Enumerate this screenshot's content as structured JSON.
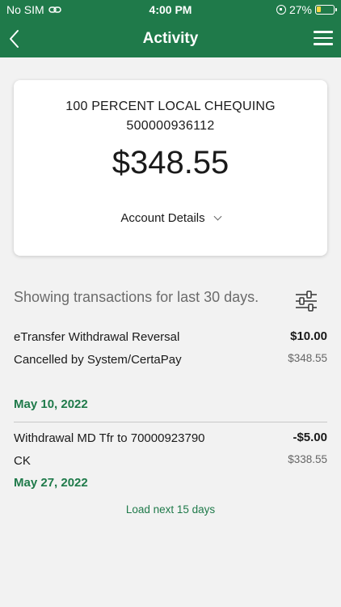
{
  "status_bar": {
    "carrier": "No SIM",
    "time": "4:00 PM",
    "battery": "27%",
    "battery_level": 0.27
  },
  "nav": {
    "title": "Activity"
  },
  "account": {
    "name": "100 PERCENT LOCAL CHEQUING",
    "number": "500000936112",
    "balance": "$348.55",
    "details_label": "Account Details"
  },
  "filter_text": "Showing transactions for last 30 days.",
  "transactions": [
    {
      "description": "eTransfer Withdrawal Reversal Cancelled by System/CertaPay",
      "amount": "$10.00",
      "balance": "$348.55",
      "date": "May 10, 2022"
    },
    {
      "description": "Withdrawal MD Tfr to 70000923790 CK",
      "amount": "-$5.00",
      "balance": "$338.55",
      "date": "May 27, 2022"
    }
  ],
  "load_more_label": "Load next 15 days",
  "colors": {
    "brand_green": "#1f7a4a",
    "background": "#f2f2f2",
    "battery_yellow": "#f5d442"
  },
  "icons": [
    "link-icon",
    "rotation-lock-icon",
    "battery-icon",
    "back-arrow-icon",
    "hamburger-menu-icon",
    "chevron-down-icon",
    "filter-sliders-icon"
  ]
}
